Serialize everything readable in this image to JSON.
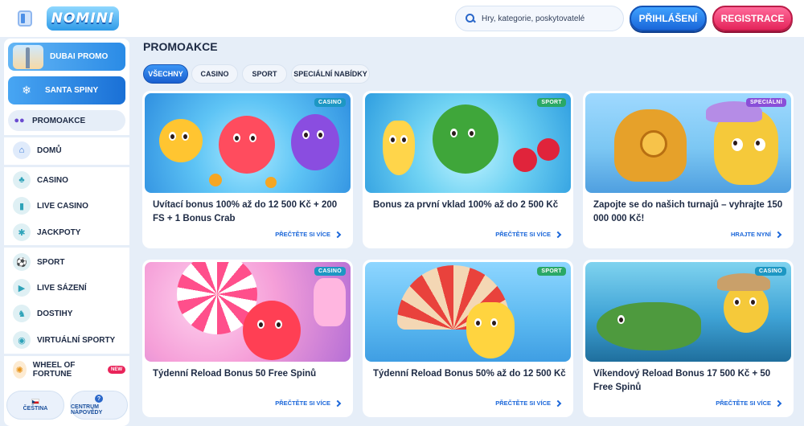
{
  "header": {
    "logo_text": "NOMINI",
    "search_placeholder": "Hry, kategorie, poskytovatelé",
    "login_label": "PŘIHLÁŠENÍ",
    "register_label": "REGISTRACE"
  },
  "sidebar": {
    "banners": [
      {
        "label": "DUBAI PROMO"
      },
      {
        "label": "SANTA SPINY"
      }
    ],
    "promo_label": "PROMOAKCE",
    "items": [
      {
        "label": "DOMŮ"
      },
      {
        "label": "CASINO"
      },
      {
        "label": "LIVE CASINO"
      },
      {
        "label": "JACKPOTY"
      },
      {
        "label": "SPORT"
      },
      {
        "label": "LIVE SÁZENÍ"
      },
      {
        "label": "DOSTIHY"
      },
      {
        "label": "VIRTUÁLNÍ SPORTY"
      },
      {
        "label": "WHEEL OF FORTUNE",
        "badge": "NEW"
      }
    ],
    "language_label": "ČEŠTINA",
    "help_label": "CENTRUM NÁPOVĚDY"
  },
  "main": {
    "title": "PROMOAKCE",
    "filters": [
      {
        "label": "VŠECHNY",
        "active": true
      },
      {
        "label": "CASINO"
      },
      {
        "label": "SPORT"
      },
      {
        "label": "SPECIÁLNÍ NABÍDKY"
      }
    ],
    "cards": [
      {
        "category": "CASINO",
        "title": "Uvítací bonus 100% až do 12 500 Kč + 200 FS + 1 Bonus Crab",
        "link": "PŘEČTĚTE SI VÍCE"
      },
      {
        "category": "SPORT",
        "title": "Bonus za první vklad 100% až do 2 500 Kč",
        "link": "PŘEČTĚTE SI VÍCE"
      },
      {
        "category": "SPECIÁLNÍ",
        "title": "Zapojte se do našich turnajů – vyhrajte 150 000 000 Kč!",
        "link": "HRAJTE NYNÍ"
      },
      {
        "category": "CASINO",
        "title": "Týdenní Reload Bonus 50 Free Spinů",
        "link": "PŘEČTĚTE SI VÍCE"
      },
      {
        "category": "SPORT",
        "title": "Týdenní Reload Bonus 50% až do 12 500 Kč",
        "link": "PŘEČTĚTE SI VÍCE"
      },
      {
        "category": "CASINO",
        "title": "Víkendový Reload Bonus 17 500 Kč + 50 Free Spinů",
        "link": "PŘEČTĚTE SI VÍCE"
      }
    ]
  },
  "colors": {
    "primary_blue": "#1a66d9",
    "register_pink": "#e4245a",
    "page_bg": "#e6eef8"
  }
}
